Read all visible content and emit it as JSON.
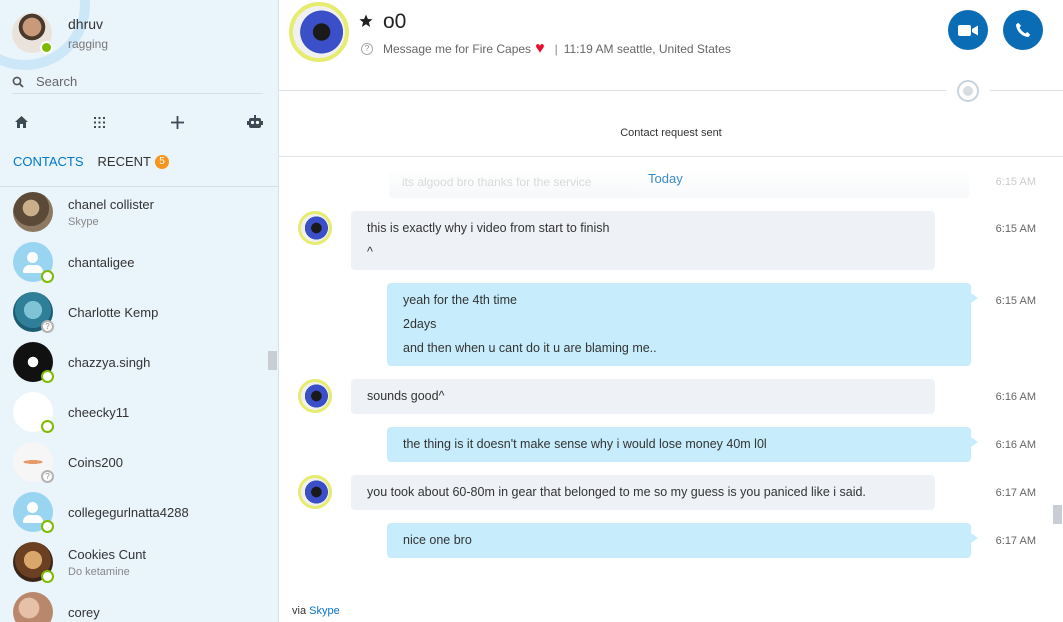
{
  "profile": {
    "name": "dhruv",
    "mood": "ragging"
  },
  "search": {
    "placeholder": "Search"
  },
  "tabs": [
    {
      "label": "CONTACTS"
    },
    {
      "label": "RECENT",
      "badge": "5"
    }
  ],
  "contacts": [
    {
      "name": "chanel collister",
      "sub": "Skype"
    },
    {
      "name": "chantaligee",
      "sub": ""
    },
    {
      "name": "Charlotte Kemp",
      "sub": ""
    },
    {
      "name": "chazzya.singh",
      "sub": ""
    },
    {
      "name": "cheecky11",
      "sub": ""
    },
    {
      "name": "Coins200",
      "sub": ""
    },
    {
      "name": "collegegurlnatta4288",
      "sub": ""
    },
    {
      "name": "Cookies Cunt",
      "sub": "Do ketamine"
    },
    {
      "name": "corey",
      "sub": ""
    }
  ],
  "conversation": {
    "name": "o0",
    "mood": "Message me for Fire Capes",
    "local_time": "11:19 AM seattle, United States",
    "contact_request": "Contact request sent",
    "faded_message": "its algood bro thanks for the service",
    "faded_time": "6:15 AM",
    "day_separator": "Today",
    "via_prefix": "via",
    "via_link": "Skype"
  },
  "messages": [
    {
      "direction": "in",
      "lines": [
        "this is exactly why i video from start to finish",
        "^"
      ],
      "time": "6:15 AM"
    },
    {
      "direction": "out",
      "lines": [
        "yeah for the 4th time",
        "2days",
        "and then when u cant do it u are blaming me.."
      ],
      "time": "6:15 AM"
    },
    {
      "direction": "in",
      "lines": [
        "sounds good^"
      ],
      "time": "6:16 AM"
    },
    {
      "direction": "out",
      "lines": [
        "the thing is it doesn't make sense why i would lose money 40m l0l"
      ],
      "time": "6:16 AM"
    },
    {
      "direction": "in",
      "lines": [
        "you took about 60-80m in gear that belonged to me so my guess is you paniced like i said."
      ],
      "time": "6:17 AM"
    },
    {
      "direction": "out",
      "lines": [
        "nice one bro"
      ],
      "time": "6:17 AM"
    }
  ],
  "colors": {
    "accent": "#0078ca",
    "call_button": "#0a6cb5",
    "badge": "#f7941d",
    "online": "#7fba00",
    "outgoing_bubble": "#c7edfc",
    "incoming_bubble": "#eef1f5"
  },
  "icons": [
    "home-icon",
    "dialpad-icon",
    "add-icon",
    "bot-icon",
    "search-icon",
    "star-icon",
    "video-call-icon",
    "audio-call-icon",
    "globe-icon",
    "heart-icon"
  ]
}
